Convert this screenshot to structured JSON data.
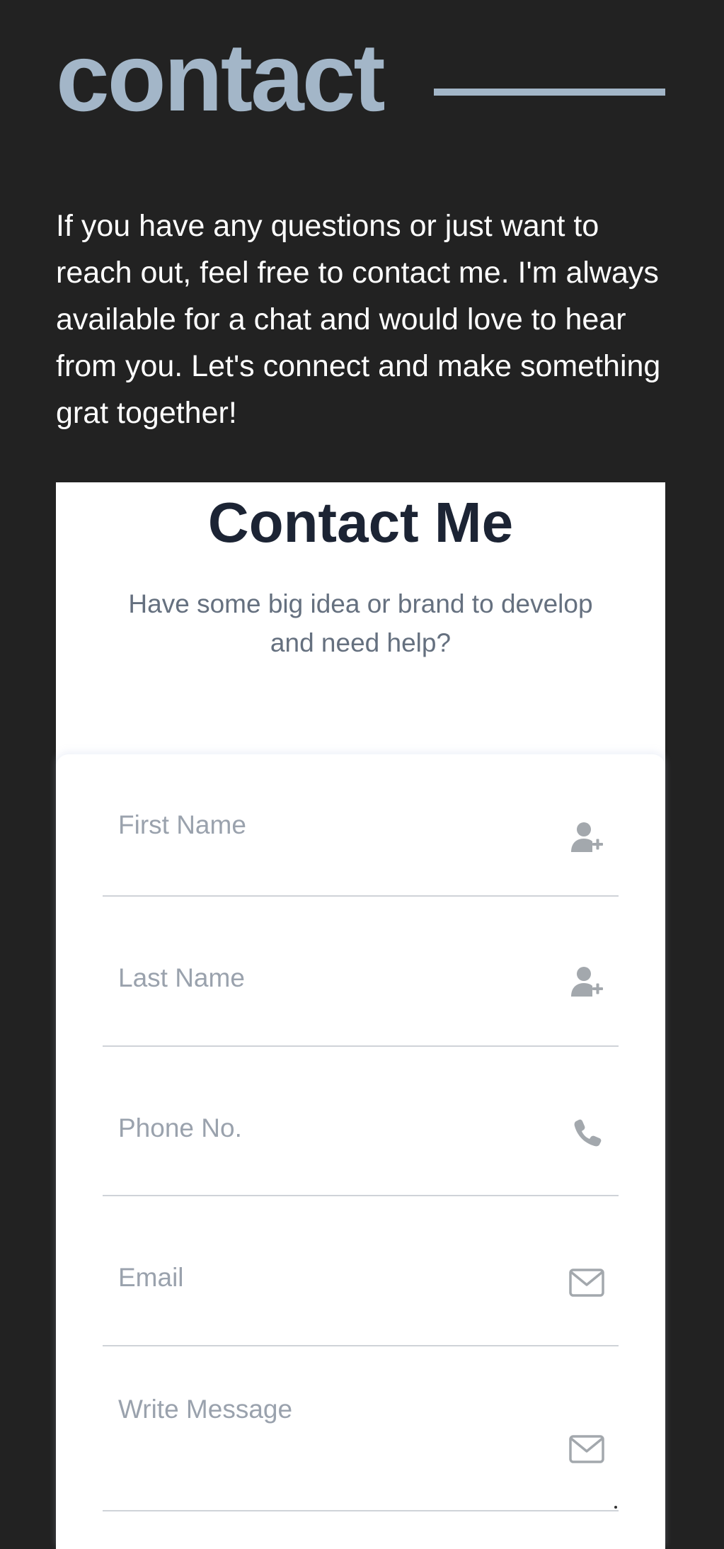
{
  "header": {
    "title": "contact"
  },
  "intro": {
    "text": "If you have any questions or just want to reach out, feel free to contact me. I'm always available for a chat and would love to hear from you. Let's connect and make something grat together!"
  },
  "contact_card": {
    "title": "Contact Me",
    "subtitle": "Have some big idea or brand to develop and need help?"
  },
  "form": {
    "first_name": {
      "placeholder": "First Name",
      "value": "",
      "icon": "user-plus-icon"
    },
    "last_name": {
      "placeholder": "Last Name",
      "value": "",
      "icon": "user-plus-icon"
    },
    "phone": {
      "placeholder": "Phone No.",
      "value": "",
      "icon": "phone-icon"
    },
    "email": {
      "placeholder": "Email",
      "value": "",
      "icon": "envelope-icon"
    },
    "message": {
      "placeholder": "Write Message",
      "value": "",
      "icon": "envelope-icon"
    }
  },
  "colors": {
    "background": "#222222",
    "accent": "#a3b6c8",
    "card_title": "#1c2434",
    "subtitle": "#65707f",
    "placeholder": "#9aa2ad",
    "icon": "#a3a8ad",
    "field_border": "#cfd3d8"
  }
}
